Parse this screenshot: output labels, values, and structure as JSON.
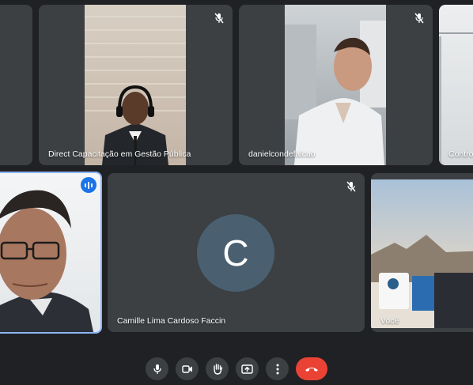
{
  "tiles": {
    "direct": {
      "name": "Direct Capacitação em Gestão Pública",
      "muted": true
    },
    "daniel": {
      "name": "danielcondefalcao",
      "muted": true
    },
    "partial_right": {
      "name": "Contro"
    },
    "speaker": {
      "speaking": true
    },
    "camille": {
      "name": "Camille Lima Cardoso Faccin",
      "initial": "C",
      "muted": true
    },
    "you": {
      "name": "Você"
    }
  },
  "toolbar": {
    "buttons": [
      "microphone",
      "camera",
      "raise-hand",
      "present",
      "more-options",
      "end-call"
    ]
  },
  "colors": {
    "background": "#202124",
    "tile": "#3c4043",
    "avatar": "#4a6070",
    "speaking_outline": "#8ab4f8",
    "end_call": "#ea4335"
  }
}
